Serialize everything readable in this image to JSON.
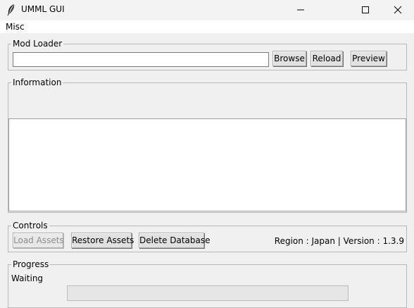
{
  "window": {
    "title": "UMML GUI"
  },
  "menu": {
    "items": [
      "Misc"
    ]
  },
  "mod_loader": {
    "legend": "Mod Loader",
    "path_value": "",
    "browse_label": "Browse",
    "reload_label": "Reload",
    "preview_label": "Preview"
  },
  "information": {
    "legend": "Information",
    "text": ""
  },
  "controls": {
    "legend": "Controls",
    "load_assets_label": "Load Assets",
    "restore_assets_label": "Restore Assets",
    "delete_database_label": "Delete Database",
    "region_version": "Region : Japan |  Version : 1.3.9"
  },
  "progress": {
    "legend": "Progress",
    "status": "Waiting",
    "value": 0
  }
}
